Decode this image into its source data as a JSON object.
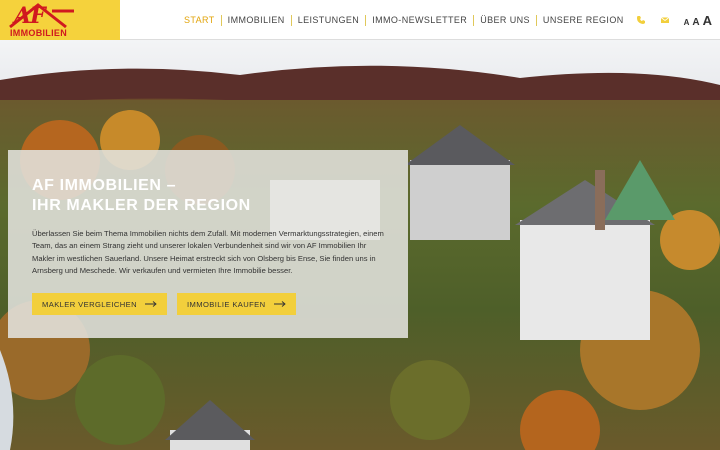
{
  "brand": {
    "logo_mark": "AF",
    "logo_sub": "IMMOBILIEN",
    "color": "#f5d23c",
    "accent": "#d0191f"
  },
  "nav": {
    "items": [
      {
        "label": "START",
        "active": true
      },
      {
        "label": "IMMOBILIEN",
        "active": false
      },
      {
        "label": "LEISTUNGEN",
        "active": false
      },
      {
        "label": "IMMO-NEWSLETTER",
        "active": false
      },
      {
        "label": "ÜBER UNS",
        "active": false
      },
      {
        "label": "UNSERE REGION",
        "active": false
      }
    ]
  },
  "tools": {
    "phone_icon": "phone-icon",
    "mail_icon": "mail-icon",
    "font_sizes": [
      "A",
      "A",
      "A"
    ]
  },
  "hero": {
    "title_line1": "AF IMMOBILIEN –",
    "title_line2": "IHR MAKLER DER REGION",
    "text": "Überlassen Sie beim Thema Immobilien nichts dem Zufall. Mit modernen Vermarktungsstrategien, einem Team, das an einem Strang zieht und unserer lokalen Verbundenheit sind wir von AF Immobilien Ihr Makler im westlichen Sauerland. Unsere Heimat erstreckt sich von Olsberg bis Ense, Sie finden uns in Arnsberg und Meschede. Wir verkaufen und vermieten Ihre Immobilie besser.",
    "button1": "MAKLER VERGLEICHEN",
    "button2": "IMMOBILIE KAUFEN"
  }
}
